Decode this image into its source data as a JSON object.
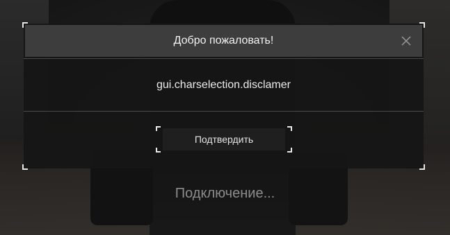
{
  "modal": {
    "title": "Добро пожаловать!",
    "close_icon": "close-icon",
    "body_text": "gui.charselection.disclamer",
    "confirm_label": "Подтвердить"
  },
  "status": {
    "text": "Подключение..."
  },
  "colors": {
    "header_bg": "#3d3d3d",
    "modal_bg": "#161616",
    "accent_corner": "#e8e8e8",
    "status_text": "#8c8c8c"
  }
}
